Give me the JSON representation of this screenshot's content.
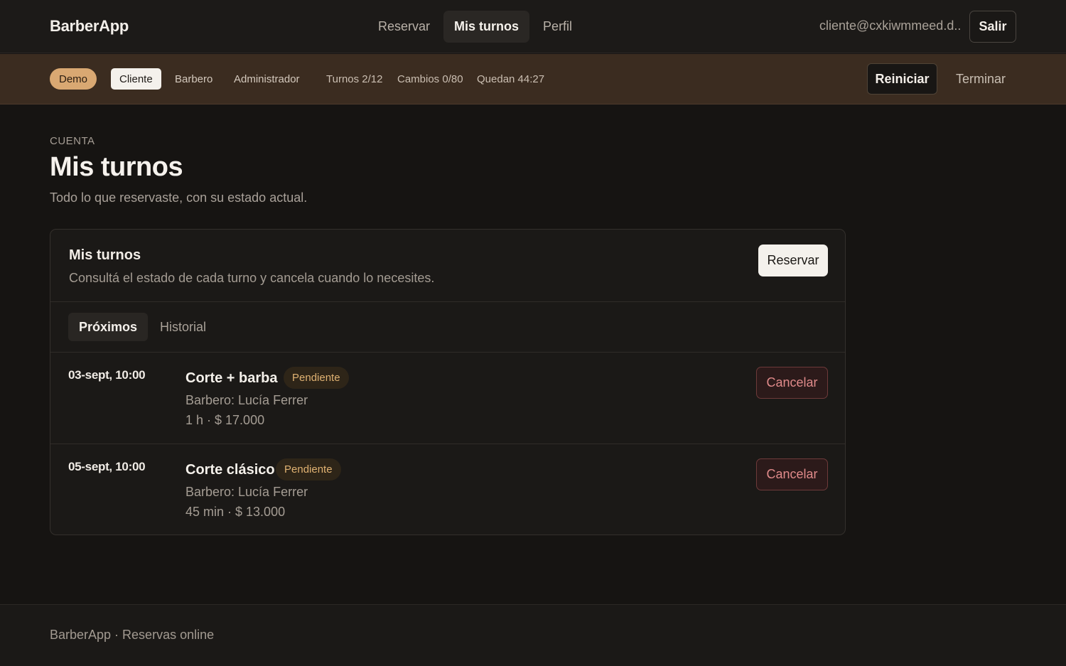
{
  "app": {
    "brand": "BarberApp"
  },
  "nav": {
    "items": [
      {
        "label": "Reservar",
        "active": false
      },
      {
        "label": "Mis turnos",
        "active": true
      },
      {
        "label": "Perfil",
        "active": false
      }
    ]
  },
  "user": {
    "email": "cliente@cxkiwmmeed.d...",
    "logout_label": "Salir"
  },
  "demo": {
    "badge": "Demo",
    "roles": [
      {
        "label": "Cliente",
        "active": true
      },
      {
        "label": "Barbero",
        "active": false
      },
      {
        "label": "Administrador",
        "active": false
      }
    ],
    "stats": {
      "turnos": "Turnos 2/12",
      "cambios": "Cambios 0/80",
      "quedan": "Quedan 44:27"
    },
    "reset_label": "Reiniciar",
    "end_label": "Terminar"
  },
  "page": {
    "eyebrow": "CUENTA",
    "title": "Mis turnos",
    "subtitle": "Todo lo que reservaste, con su estado actual."
  },
  "card": {
    "title": "Mis turnos",
    "subtitle": "Consultá el estado de cada turno y cancela cuando lo necesites.",
    "reserve_label": "Reservar",
    "tabs": [
      {
        "label": "Próximos",
        "active": true
      },
      {
        "label": "Historial",
        "active": false
      }
    ],
    "appointments": [
      {
        "date": "03-sept, 10:00",
        "service": "Corte + barba",
        "status": "Pendiente",
        "barber": "Barbero: Lucía Ferrer",
        "meta": "1 h · $ 17.000",
        "cancel_label": "Cancelar"
      },
      {
        "date": "05-sept, 10:00",
        "service": "Corte clásico",
        "status": "Pendiente",
        "barber": "Barbero: Lucía Ferrer",
        "meta": "45 min · $ 13.000",
        "cancel_label": "Cancelar"
      }
    ]
  },
  "footer": {
    "text": "BarberApp · Reservas online"
  },
  "colors": {
    "background": "#161412",
    "demo_bar": "#3b2c20",
    "demo_accent": "#d9a872",
    "pending": "#e0b272",
    "danger": "#e08a8a"
  }
}
